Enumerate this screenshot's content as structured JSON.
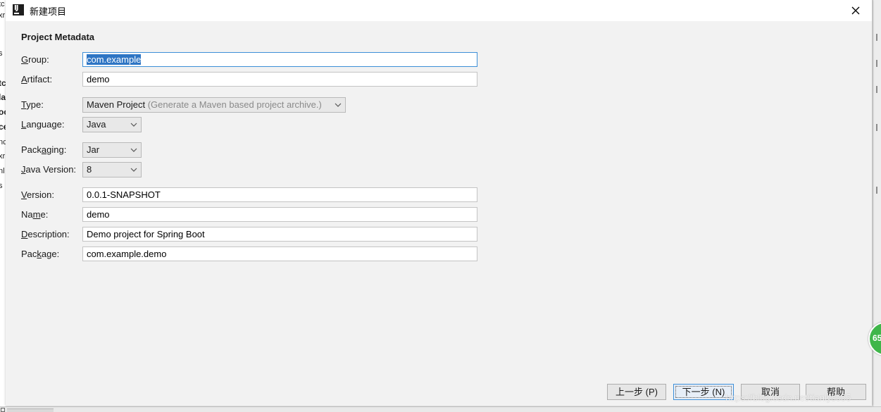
{
  "dialog": {
    "title": "新建项目",
    "app_icon": "intellij-idea-icon",
    "close_icon": "close-icon"
  },
  "section_title": "Project Metadata",
  "fields": {
    "group": {
      "label_pre": "",
      "label_mn": "G",
      "label_post": "roup:",
      "value": "com.example"
    },
    "artifact": {
      "label_pre": "",
      "label_mn": "A",
      "label_post": "rtifact:",
      "value": "demo"
    },
    "type": {
      "label_pre": "",
      "label_mn": "T",
      "label_post": "ype:",
      "value": "Maven Project",
      "hint": "(Generate a Maven based project archive.)"
    },
    "language": {
      "label_pre": "",
      "label_mn": "L",
      "label_post": "anguage:",
      "value": "Java"
    },
    "packaging": {
      "label_pre": "Pack",
      "label_mn": "a",
      "label_post": "ging:",
      "value": "Jar"
    },
    "java_version": {
      "label_pre": "",
      "label_mn": "J",
      "label_post": "ava Version:",
      "value": "8"
    },
    "version": {
      "label_pre": "",
      "label_mn": "V",
      "label_post": "ersion:",
      "value": "0.0.1-SNAPSHOT"
    },
    "name": {
      "label_pre": "Na",
      "label_mn": "m",
      "label_post": "e:",
      "value": "demo"
    },
    "description": {
      "label_pre": "",
      "label_mn": "D",
      "label_post": "escription:",
      "value": "Demo project for Spring Boot"
    },
    "package": {
      "label_pre": "Pac",
      "label_mn": "k",
      "label_post": "age:",
      "value": "com.example.demo"
    }
  },
  "buttons": {
    "previous": "上一步 (P)",
    "next": "下一步 (N)",
    "cancel": "取消",
    "help": "帮助"
  },
  "overlay": {
    "badge_text": "65",
    "watermark": "https://blog.csdn.net/tianlys555"
  },
  "background_fragments": {
    "left": [
      "s",
      "tc",
      "la",
      "oc",
      "ce",
      "nc",
      "xr",
      "nl",
      "s"
    ]
  },
  "colors": {
    "focus_border": "#3d8fd8",
    "selection": "#2e75c4",
    "badge": "#3fb64a"
  }
}
